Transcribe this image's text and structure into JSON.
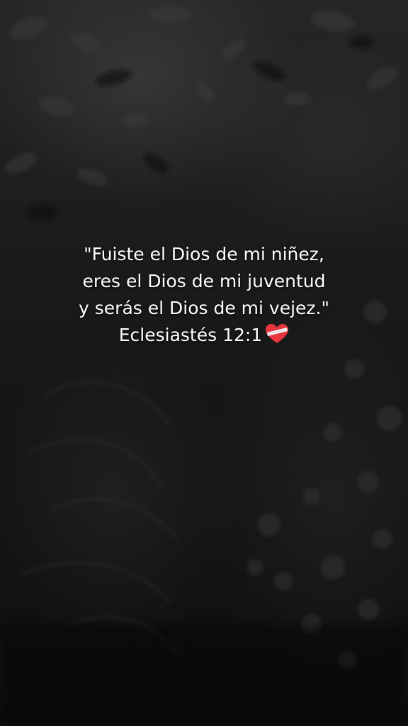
{
  "quote": {
    "lines": [
      "\"Fuiste el Dios de mi niñez,",
      "eres el Dios de mi juventud",
      "y serás el Dios de mi vejez.\"",
      "Eclesiastés 12:1"
    ],
    "emoji": "mending-heart-icon"
  },
  "colors": {
    "text": "#ffffff",
    "heart": "#e8343e",
    "bandage": "#f2f2f2"
  }
}
